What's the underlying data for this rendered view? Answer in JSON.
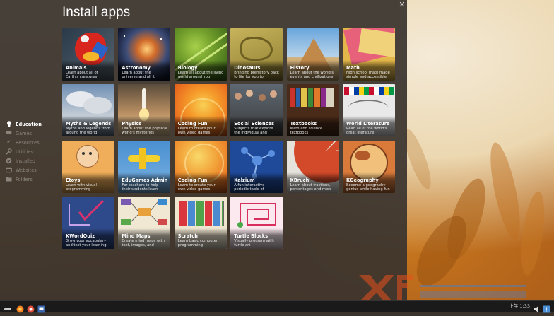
{
  "title": "Install apps",
  "sidebar": {
    "items": [
      {
        "label": "Education",
        "icon": "lightbulb-icon"
      },
      {
        "label": "Games",
        "icon": "gamepad-icon"
      },
      {
        "label": "Resources",
        "icon": "checkmark-icon"
      },
      {
        "label": "Utilities",
        "icon": "wrench-icon"
      },
      {
        "label": "Installed",
        "icon": "installed-icon"
      },
      {
        "label": "Websites",
        "icon": "globe-icon"
      },
      {
        "label": "Folders",
        "icon": "folder-icon"
      }
    ],
    "active": "Education"
  },
  "apps": [
    {
      "title": "Animals",
      "desc": "Learn about all of Earth's creatures",
      "art": "parrot"
    },
    {
      "title": "Astronomy",
      "desc": "Learn about the universe and all it contains",
      "art": "nebula"
    },
    {
      "title": "Biology",
      "desc": "Learn all about the living world around you",
      "art": "leaf"
    },
    {
      "title": "Dinosaurs",
      "desc": "Bringing prehistory back to life for you to discover...",
      "art": "fossil"
    },
    {
      "title": "History",
      "desc": "Learn about the world's events and civilizations",
      "art": "pyramid"
    },
    {
      "title": "Math",
      "desc": "High school math made simple and accessible",
      "art": "paper"
    },
    {
      "title": "Myths & Legends",
      "desc": "Myths and legends from around the world",
      "art": "clouds"
    },
    {
      "title": "Physics",
      "desc": "Learn about the physical world's mysteries",
      "art": "rocket"
    },
    {
      "title": "Coding Fun",
      "desc": "Learn to create your own video games",
      "art": "orange"
    },
    {
      "title": "Social Sciences",
      "desc": "Subjects that explore the individual and society",
      "art": "crowd"
    },
    {
      "title": "Textbooks",
      "desc": "Math and science textbooks",
      "art": "books"
    },
    {
      "title": "World Literature",
      "desc": "Read all of the world's great literature",
      "art": "flags"
    },
    {
      "title": "Etoys",
      "desc": "Learn with visual programming",
      "art": "etoys"
    },
    {
      "title": "EduGames Admin",
      "desc": "For teachers to help their students learn",
      "art": "plane"
    },
    {
      "title": "Coding Fun",
      "desc": "Learn to create your own video games",
      "art": "orange2"
    },
    {
      "title": "Kalzium",
      "desc": "A fun interactive periodic table of elements",
      "art": "molecule"
    },
    {
      "title": "KBruch",
      "desc": "Learn about fractions, percentages and more",
      "art": "fraction"
    },
    {
      "title": "KGeography",
      "desc": "Become a geography genius while having fun",
      "art": "globe"
    },
    {
      "title": "KWordQuiz",
      "desc": "Grow your vocabulary and test your learning",
      "art": "quiz"
    },
    {
      "title": "Mind Maps",
      "desc": "Create mind maps with text, images, and drawings",
      "art": "mindmap"
    },
    {
      "title": "Scratch",
      "desc": "Learn basic computer programming",
      "art": "scratch"
    },
    {
      "title": "Turtle Blocks",
      "desc": "Visually program with turtle art",
      "art": "turtle"
    }
  ],
  "taskbar": {
    "clock": "上午 1:33",
    "items": [
      "app-menu-icon",
      "browser-icon",
      "files-icon",
      "app-grid-icon"
    ]
  },
  "colors": {
    "overlay": "#3a342e",
    "accent": "#ffffff"
  }
}
